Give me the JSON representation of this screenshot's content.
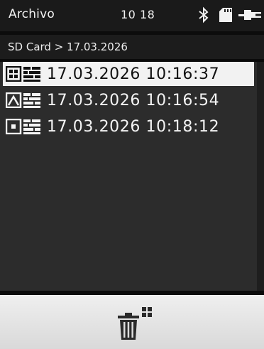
{
  "status": {
    "title": "Archivo",
    "time": "10 18",
    "icons": [
      "bluetooth-icon",
      "sd-card-icon",
      "power-plug-icon"
    ]
  },
  "breadcrumb": {
    "text": "SD Card > 17.03.2026"
  },
  "files": [
    {
      "icon": "grid-image-icon",
      "label": "17.03.2026 10:16:37",
      "selected": true
    },
    {
      "icon": "triangle-image-icon",
      "label": "17.03.2026 10:16:54",
      "selected": false
    },
    {
      "icon": "square-image-icon",
      "label": "17.03.2026 10:18:12",
      "selected": false
    }
  ],
  "toolbar": {
    "delete_icon": "trash-multiple-icon"
  },
  "colors": {
    "background": "#2b2b2b",
    "statusbar": "#1a1a1a",
    "selected_row": "#f2f2f2",
    "bottom_bar": "#e6e6e6"
  }
}
